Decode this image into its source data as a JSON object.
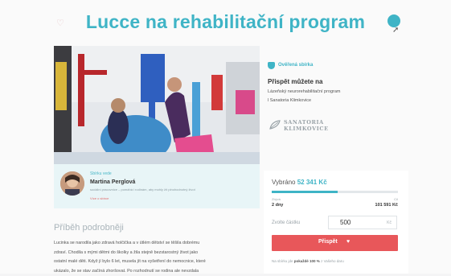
{
  "title": "Lucce na rehabilitační program",
  "coach": {
    "role": "Sbírku vede",
    "name": "Martina Perglová",
    "description": "sociální pracovnice – pomáhá i rodinám, aby mohly žít plnohodnotný život",
    "link": "Více o sbírce"
  },
  "story": {
    "heading": "Příběh podrobněji",
    "lines": [
      "Lucinka se narodila jako zdravá holčička a v útlém dětství se těšila dobrému",
      "zdraví. Chodila s mými dětmi do školky a žila stejně bezstarostný život jako",
      "ostatní malé děti. Když jí bylo 6 let, musela jít na vyšetření do nemocnice, které",
      "ukázalo, že se stav začíná zhoršovat. Po rozhodnutí se rodina ale nevzdala"
    ]
  },
  "verified": "Ověřená sbírka",
  "contribute": {
    "heading": "Přispět můžete na",
    "line1": "Lázeňský neurorehabilitační program",
    "line2": "l Sanatoria Klimkovice"
  },
  "partner": {
    "line1": "SANATORIA",
    "line2": "KLIMKOVICE"
  },
  "donation": {
    "collected_label": "Vybráno",
    "collected_value": "52 341 Kč",
    "progress": 0.52,
    "remaining_label": "Zbývá",
    "remaining_value": "2 dny",
    "goal_label": "Cíl",
    "goal_value": "101 591 Kč",
    "amount_label": "Zvolte částku",
    "amount_value": "500",
    "currency": "Kč",
    "button_label": "Přispět",
    "note_prefix": "Na sbírku jde",
    "note_bold": "pokaždé 100 %",
    "note_suffix": "z Vašeho daru"
  },
  "icons": {
    "heart": "heart-icon",
    "share": "share-icon",
    "verified": "shield-icon"
  },
  "colors": {
    "accent": "#3fb4c6",
    "button": "#e8575a"
  }
}
